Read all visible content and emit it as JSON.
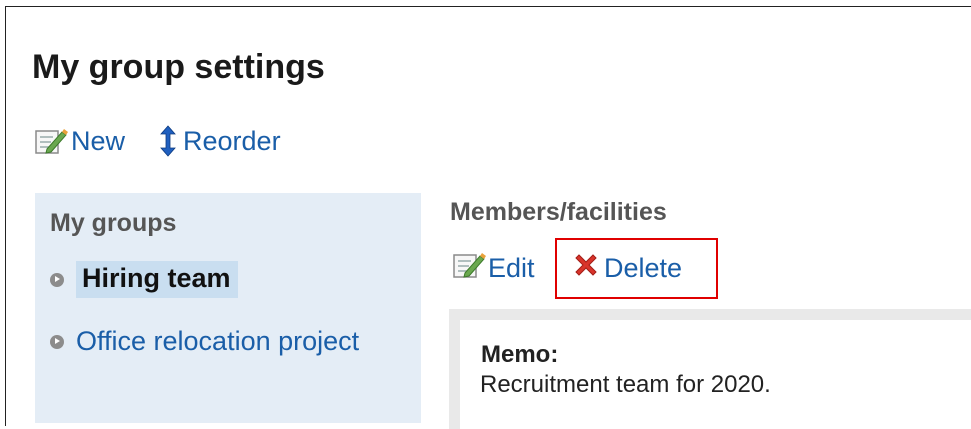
{
  "page": {
    "title": "My group settings"
  },
  "toolbar": {
    "new_label": "New",
    "reorder_label": "Reorder"
  },
  "sidebar": {
    "heading": "My groups",
    "groups": [
      {
        "label": "Hiring team",
        "selected": true
      },
      {
        "label": "Office relocation project",
        "selected": false
      }
    ]
  },
  "main": {
    "section_title": "Members/facilities",
    "edit_label": "Edit",
    "delete_label": "Delete",
    "memo_label": "Memo:",
    "memo_text": "Recruitment team for 2020."
  },
  "colors": {
    "link": "#1a5ea8",
    "sidebar_bg": "#e4edf6",
    "selected_bg": "#c9def0",
    "highlight": "#e00000",
    "delete_x": "#d9342b"
  },
  "icons": [
    "new-icon",
    "reorder-icon",
    "edit-icon",
    "delete-icon",
    "bullet-icon"
  ]
}
